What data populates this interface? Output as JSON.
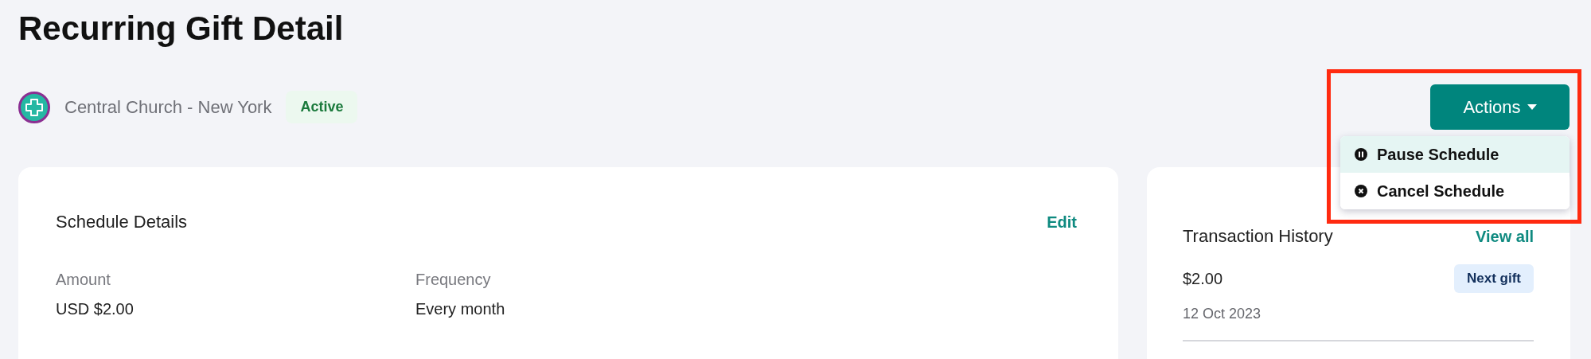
{
  "page_title": "Recurring Gift Detail",
  "organization": {
    "name": "Central Church - New York",
    "status": "Active"
  },
  "actions": {
    "label": "Actions",
    "expanded": true,
    "highlighted": true,
    "menu": [
      {
        "label": "Pause Schedule",
        "kind": "pause",
        "selected": true
      },
      {
        "label": "Cancel Schedule",
        "kind": "cancel",
        "selected": false
      }
    ]
  },
  "schedule_details": {
    "title": "Schedule Details",
    "edit_link": "Edit",
    "fields": [
      {
        "label": "Amount",
        "value": "USD $2.00"
      },
      {
        "label": "Frequency",
        "value": "Every month"
      }
    ]
  },
  "transaction_history": {
    "title": "Transaction History",
    "view_all_link": "View all",
    "transactions": [
      {
        "amount": "$2.00",
        "date": "12 Oct 2023",
        "badge": "Next gift"
      }
    ]
  }
}
